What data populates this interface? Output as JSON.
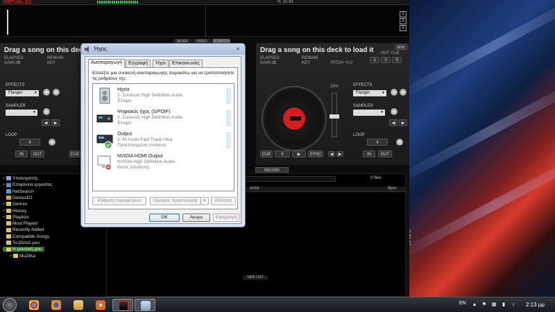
{
  "vdj": {
    "logo": "VIRTUAL DJ",
    "clock": "Η, 15:43",
    "deck_numbers": [
      "1",
      "2",
      "3"
    ],
    "mode_tabs": [
      "MIXER",
      "VIDEO",
      "SCRATCH"
    ],
    "left_deck": {
      "title": "Drag a song on this deck to load it",
      "elapsed": "ELAPSED",
      "gain": "GAIN dB",
      "remain": "REMAIN",
      "key": "KEY",
      "effects_label": "EFFECTS",
      "effect_value": "Flanger",
      "sampler_label": "SAMPLER",
      "loop_label": "LOOP",
      "loop_value": "4",
      "in_label": "IN",
      "out_label": "OUT",
      "cue_label": "CUE"
    },
    "right_deck": {
      "title": "Drag a song on this deck to load it",
      "elapsed": "ELAPSED",
      "gain": "GAIN dB",
      "remain": "REMAIN",
      "key": "KEY",
      "pitch": "PITCH +0.0",
      "bpm_badge": "BPM",
      "hot_cue": "HOT CUE",
      "hot_cues": [
        "1",
        "2",
        "3"
      ],
      "effects_label": "EFFECTS",
      "effect_value": "Flanger",
      "sampler_label": "SAMPLER",
      "loop_label": "LOOP",
      "loop_value": "4",
      "in_label": "IN",
      "out_label": "OUT",
      "pitch_pct": "33%",
      "transport": [
        "CUE",
        "II",
        "▶",
        "SYNC"
      ]
    },
    "record_label": "RECORD",
    "browser": {
      "tree": [
        {
          "label": "Υπολογιστής",
          "expander": "+",
          "indent": 0,
          "icon": "computer-icon"
        },
        {
          "label": "Επιφάνεια εργασίας",
          "expander": "+",
          "indent": 0,
          "icon": "desktop-icon"
        },
        {
          "label": "NetSearch",
          "expander": "",
          "indent": 0,
          "icon": "netsearch-icon"
        },
        {
          "label": "GeniusDJ",
          "expander": "",
          "indent": 0,
          "icon": "geniusdj-icon"
        },
        {
          "label": "Genres",
          "expander": "+",
          "indent": 0,
          "icon": "folder-icon"
        },
        {
          "label": "History",
          "expander": "+",
          "indent": 0,
          "icon": "folder-icon"
        },
        {
          "label": "Playlists",
          "expander": "+",
          "indent": 0,
          "icon": "folder-icon"
        },
        {
          "label": "Most Played",
          "expander": "",
          "indent": 0,
          "icon": "folder-icon"
        },
        {
          "label": "Recently Added",
          "expander": "",
          "indent": 0,
          "icon": "folder-icon"
        },
        {
          "label": "Compatible Songs",
          "expander": "",
          "indent": 0,
          "icon": "folder-icon"
        },
        {
          "label": "Τα βίντεό μου",
          "expander": "",
          "indent": 0,
          "icon": "folder-icon"
        },
        {
          "label": "Η μουσική μου",
          "expander": "-",
          "indent": 0,
          "icon": "folder-icon",
          "selected": true
        },
        {
          "label": "MuZIKa",
          "expander": "+",
          "indent": 1,
          "icon": "folder-icon"
        }
      ],
      "files_count": "0 files",
      "columns": [
        "Artist",
        "Bpm"
      ],
      "side_list": "SIDE LIST",
      "playlist_tab": "PLAYLIST"
    }
  },
  "dialog": {
    "title": "Ήχος",
    "tabs": [
      "Αναπαραγωγή",
      "Εγγραφή",
      "Ήχοι",
      "Επικοινωνίες"
    ],
    "active_tab": 0,
    "instructions": "Επιλέξτε μια συσκευή αναπαραγωγής παρακάτω για να τροποποιήσετε τις ρυθμίσεις της:",
    "devices": [
      {
        "name": "Ηχεία",
        "sub": "2- Συσκευή High Definition Audio",
        "status": "Έτοιμο",
        "icon": "speakers-icon"
      },
      {
        "name": "Ψηφιακός ήχος (S/PDIF)",
        "sub": "2- Συσκευή High Definition Audio",
        "status": "Έτοιμο",
        "icon": "spdif-icon"
      },
      {
        "name": "Output",
        "sub": "3- M-Audio Fast Track Ultra",
        "status": "Προεπιλεγμένη συσκευή",
        "icon": "audio-interface-icon",
        "default": true
      },
      {
        "name": "NVIDIA HDMI Output",
        "sub": "NVIDIA High Definition Audio",
        "status": "Εκτός σύνδεσης",
        "icon": "hdmi-monitor-icon",
        "offline": true
      }
    ],
    "buttons": {
      "configure": "Ρύθμιση παραμέτρων",
      "set_default": "Ορισμός προεπιλογής",
      "properties": "Ιδιότητες",
      "ok": "OK",
      "cancel": "Άκυρο",
      "apply": "Εφαρμογή"
    },
    "close_glyph": "×"
  },
  "taskbar": {
    "language": "EN",
    "time": "2:13 μμ"
  }
}
